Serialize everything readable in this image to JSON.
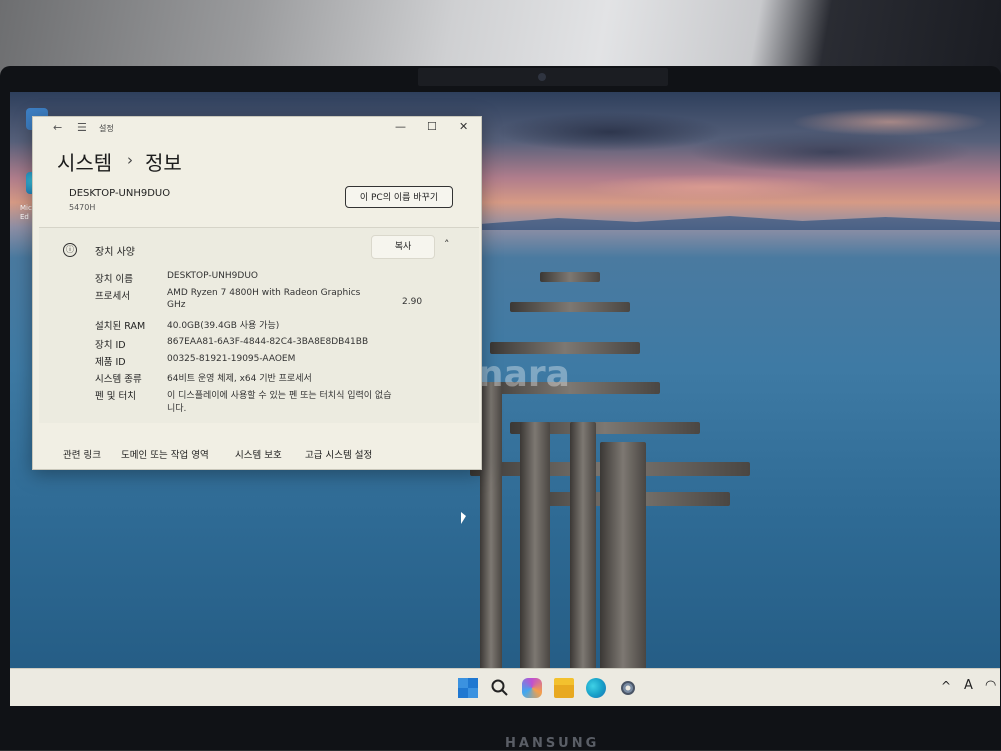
{
  "window": {
    "title": "설정",
    "minimize": "—",
    "maximize": "☐",
    "close": "✕",
    "breadcrumb_parent": "시스템",
    "breadcrumb_sep": "›",
    "breadcrumb_current": "정보"
  },
  "device": {
    "pc_name": "DESKTOP-UNH9DUO",
    "model": "5470H",
    "rename_button": "이 PC의 이름 바꾸기"
  },
  "specs": {
    "header_icon": "ⓘ",
    "header": "장치 사양",
    "copy_button": "복사",
    "collapse_icon": "˄",
    "rows": [
      {
        "label": "장치 이름",
        "value": "DESKTOP-UNH9DUO"
      },
      {
        "label": "프로세서",
        "value": "AMD Ryzen 7 4800H with Radeon Graphics",
        "value_line2": "GHz",
        "extra": "2.90"
      },
      {
        "label": "설치된 RAM",
        "value": "40.0GB(39.4GB 사용 가능)"
      },
      {
        "label": "장치 ID",
        "value": "867EAA81-6A3F-4844-82C4-3BA8E8DB41BB"
      },
      {
        "label": "제품 ID",
        "value": "00325-81921-19095-AAOEM"
      },
      {
        "label": "시스템 종류",
        "value": "64비트 운영 체제, x64 기반 프로세서"
      },
      {
        "label": "펜 및 터치",
        "value": "이 디스플레이에 사용할 수 있는 펜 또는 터치식 입력이 없습",
        "value_line2": "니다."
      }
    ]
  },
  "related_links": {
    "label": "관련 링크",
    "items": [
      "도메인 또는 작업 영역",
      "시스템 보호",
      "고급 시스템 설정"
    ]
  },
  "desktop": {
    "icon_label": "Micro Ed",
    "watermark": "joongonara"
  },
  "taskbar": {
    "apps": [
      "start-icon",
      "search-icon",
      "copilot-icon",
      "file-explorer-icon",
      "edge-icon",
      "settings-icon"
    ],
    "tray_chevron": "^",
    "ime": "A",
    "wifi": "◠"
  },
  "hardware": {
    "brand": "HANSUNG"
  },
  "colors": {
    "window_bg": "#f1efe4",
    "taskbar_bg": "#eceae1",
    "start_blue": "#1f78d1",
    "copilot": "#c04fd0",
    "explorer": "#f3c12e",
    "edge": "#19a3c9"
  }
}
